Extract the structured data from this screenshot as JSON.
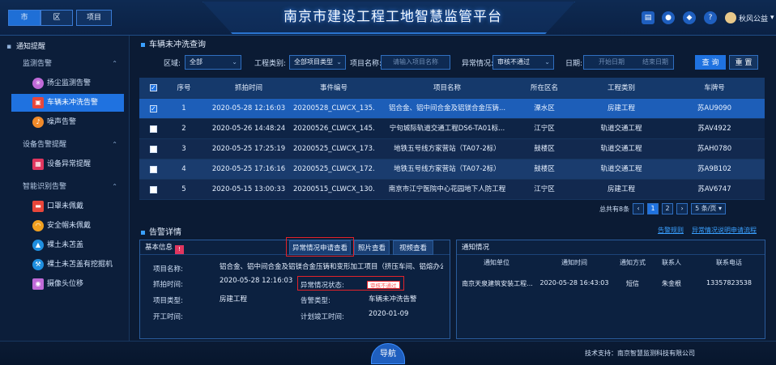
{
  "topbar": {
    "levels": [
      "市",
      "区",
      "项目"
    ],
    "title": "南京市建设工程工地智慧监管平台",
    "icons": [
      "document-icon",
      "user-icon",
      "shield-icon",
      "help-icon"
    ],
    "user_name": "秋风公益"
  },
  "sidebar": {
    "header": "通知提醒",
    "groups": [
      {
        "label": "监测告警",
        "items": [
          {
            "label": "扬尘监测告警",
            "icon": "dust-icon",
            "color": "#c06ad8"
          },
          {
            "label": "车辆未冲洗告警",
            "icon": "car-icon",
            "color": "#e8463a",
            "active": true
          },
          {
            "label": "噪声告警",
            "icon": "noise-icon",
            "color": "#f08a2a"
          }
        ]
      },
      {
        "label": "设备告警提醒",
        "items": [
          {
            "label": "设备异常提醒",
            "icon": "device-icon",
            "color": "#e0365f"
          }
        ]
      },
      {
        "label": "智能识别告警",
        "items": [
          {
            "label": "口罩未佩戴",
            "icon": "mask-icon",
            "color": "#e8463a"
          },
          {
            "label": "安全帽未佩戴",
            "icon": "helmet-icon",
            "color": "#f0a020"
          },
          {
            "label": "裸土未苫盖",
            "icon": "soil-icon",
            "color": "#1f8fe0"
          },
          {
            "label": "裸土未苫盖有挖掘机",
            "icon": "excavator-icon",
            "color": "#1f8fe0"
          },
          {
            "label": "摄像头位移",
            "icon": "camera-icon",
            "color": "#c06ad8"
          }
        ]
      }
    ]
  },
  "query": {
    "title": "车辆未冲洗查询",
    "area_label": "区域:",
    "area_value": "全部",
    "type_label": "工程类别:",
    "type_value": "全部项目类型",
    "name_label": "项目名称:",
    "name_placeholder": "请输入项目名称",
    "abnormal_label": "异常情况:",
    "abnormal_value": "审核不通过",
    "date_label": "日期:",
    "start_placeholder": "开始日期",
    "end_placeholder": "结束日期",
    "search_button": "查 询",
    "reset_button": "重 置"
  },
  "table": {
    "headers": [
      "序号",
      "抓拍时间",
      "事件编号",
      "项目名称",
      "所在区名",
      "工程类别",
      "车牌号"
    ],
    "rows": [
      {
        "no": "1",
        "time": "2020-05-28 12:16:03",
        "event": "20200528_CLWCX_135...",
        "project": "铝合金、铝中间合金及铝镁合金压铸...",
        "district": "溧水区",
        "category": "房建工程",
        "plate": "苏AU9090",
        "checked": true
      },
      {
        "no": "2",
        "time": "2020-05-26 14:48:24",
        "event": "20200526_CLWCX_145...",
        "project": "宁句城际轨道交通工程DS6-TA01标...",
        "district": "江宁区",
        "category": "轨道交通工程",
        "plate": "苏AV4922",
        "checked": false
      },
      {
        "no": "3",
        "time": "2020-05-25 17:25:19",
        "event": "20200525_CLWCX_173...",
        "project": "地铁五号线方家营站（TA07-2标）",
        "district": "鼓楼区",
        "category": "轨道交通工程",
        "plate": "苏AH0780",
        "checked": false
      },
      {
        "no": "4",
        "time": "2020-05-25 17:16:16",
        "event": "20200525_CLWCX_172...",
        "project": "地铁五号线方家营站（TA07-2标）",
        "district": "鼓楼区",
        "category": "轨道交通工程",
        "plate": "苏A9B102",
        "checked": false
      },
      {
        "no": "5",
        "time": "2020-05-15 13:00:33",
        "event": "20200515_CLWCX_130...",
        "project": "南京市江宁医院中心花园地下人防工程",
        "district": "江宁区",
        "category": "房建工程",
        "plate": "苏AV6747",
        "checked": false
      }
    ]
  },
  "pager": {
    "total": "总共有8条",
    "pages": [
      "1",
      "2"
    ],
    "current": "1",
    "page_size": "5 条/页"
  },
  "detail": {
    "title": "告警详情",
    "links": [
      "告警规则",
      "异常情况说明申请流程"
    ],
    "basic_title": "基本信息",
    "tabs": [
      "异常情况申请查看",
      "照片查看",
      "视频查看"
    ],
    "project_label": "项目名称:",
    "project_value": "铝合金、铝中间合金及铝镁合金压铸和变形加工项目（挤压车间、铝熔办公...",
    "snap_label": "抓拍时间:",
    "snap_value": "2020-05-28 12:16:03",
    "status_label": "异常情况状态:",
    "status_value": "审核不通过",
    "category_label": "项目类型:",
    "category_value": "房建工程",
    "alarm_type_label": "告警类型:",
    "alarm_type_value": "车辆未冲洗告警",
    "start_label": "开工时间:",
    "start_value": "",
    "plan_label": "计划竣工时间:",
    "plan_value": "2020-01-09"
  },
  "notice": {
    "title": "通知情况",
    "headers": [
      "通知单位",
      "通知时间",
      "通知方式",
      "联系人",
      "联系电话"
    ],
    "row": [
      "南京天泉建筑安装工程...",
      "2020-05-28 16:43:03",
      "短信",
      "朱金根",
      "13357823538"
    ]
  },
  "footer": {
    "nav_button": "导航",
    "copyright": "技术支持：南京智慧监测科技有限公司"
  }
}
